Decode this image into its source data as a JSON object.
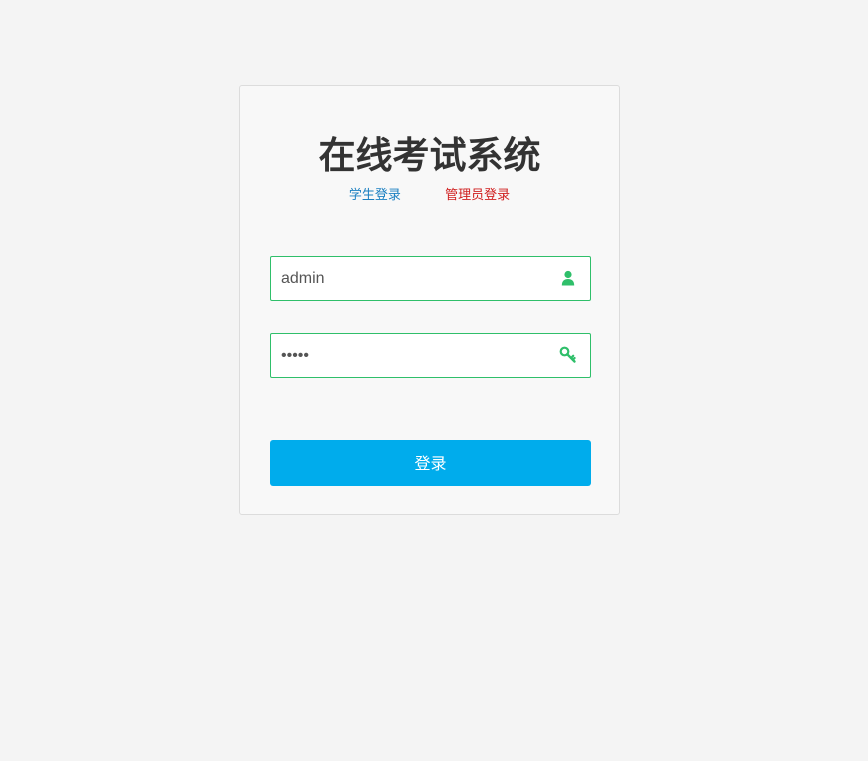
{
  "login": {
    "title": "在线考试系统",
    "roles": {
      "student_label": "学生登录",
      "admin_label": "管理员登录"
    },
    "username": {
      "value": "admin",
      "icon": "user-icon"
    },
    "password": {
      "value": "•••••",
      "icon": "key-icon"
    },
    "submit_label": "登录"
  },
  "colors": {
    "background": "#f4f4f4",
    "card_background": "#f8f8f8",
    "field_border": "#2fbf6a",
    "icon": "#2fbf6a",
    "button": "#00acec",
    "student_link": "#1a7fc1",
    "admin_link": "#d01f1f",
    "title": "#333333"
  }
}
